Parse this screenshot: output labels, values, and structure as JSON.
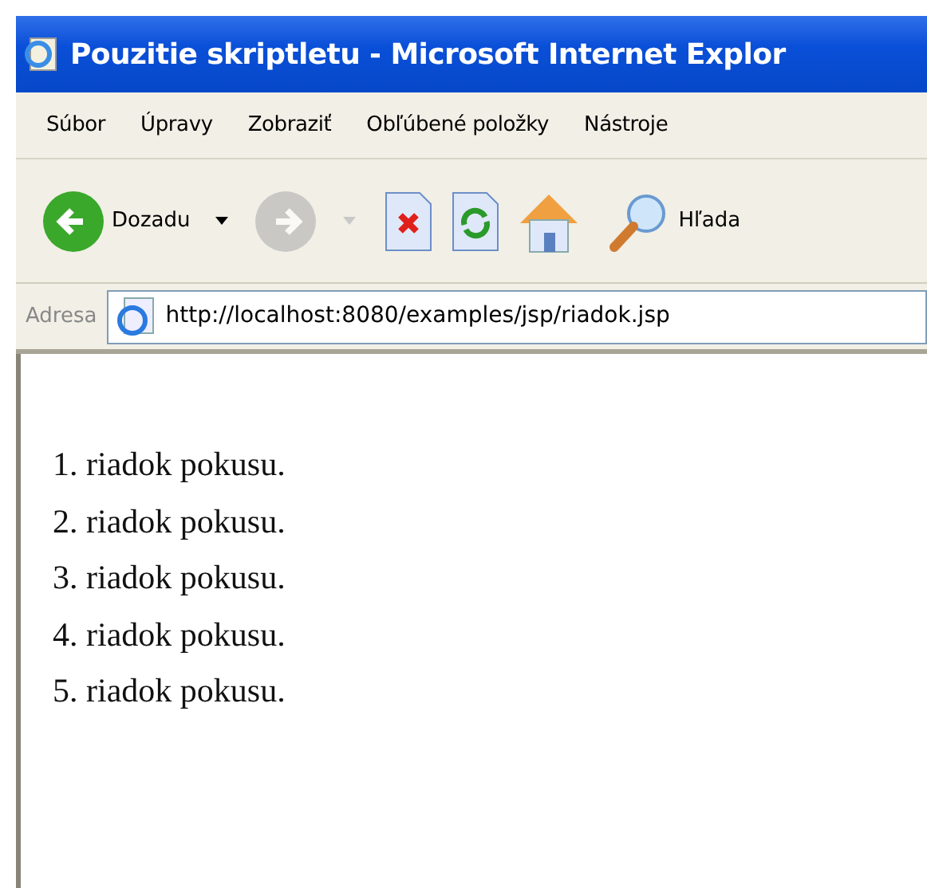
{
  "window": {
    "title": "Pouzitie skriptletu - Microsoft Internet Explor"
  },
  "menu": [
    "Súbor",
    "Úpravy",
    "Zobraziť",
    "Obľúbené položky",
    "Nástroje"
  ],
  "toolbar": [
    {
      "kind": "back",
      "label": "Dozadu",
      "disabled": false
    },
    {
      "kind": "forward",
      "disabled": true
    },
    {
      "kind": "stop"
    },
    {
      "kind": "refresh"
    },
    {
      "kind": "home"
    },
    {
      "kind": "search",
      "label": "Hľada"
    }
  ],
  "address": {
    "label": "Adresa",
    "value": "http://localhost:8080/examples/jsp/riadok.jsp"
  },
  "content": {
    "lines": [
      "1. riadok pokusu.",
      "2. riadok pokusu.",
      "3. riadok pokusu.",
      "4. riadok pokusu.",
      "5. riadok pokusu."
    ]
  }
}
